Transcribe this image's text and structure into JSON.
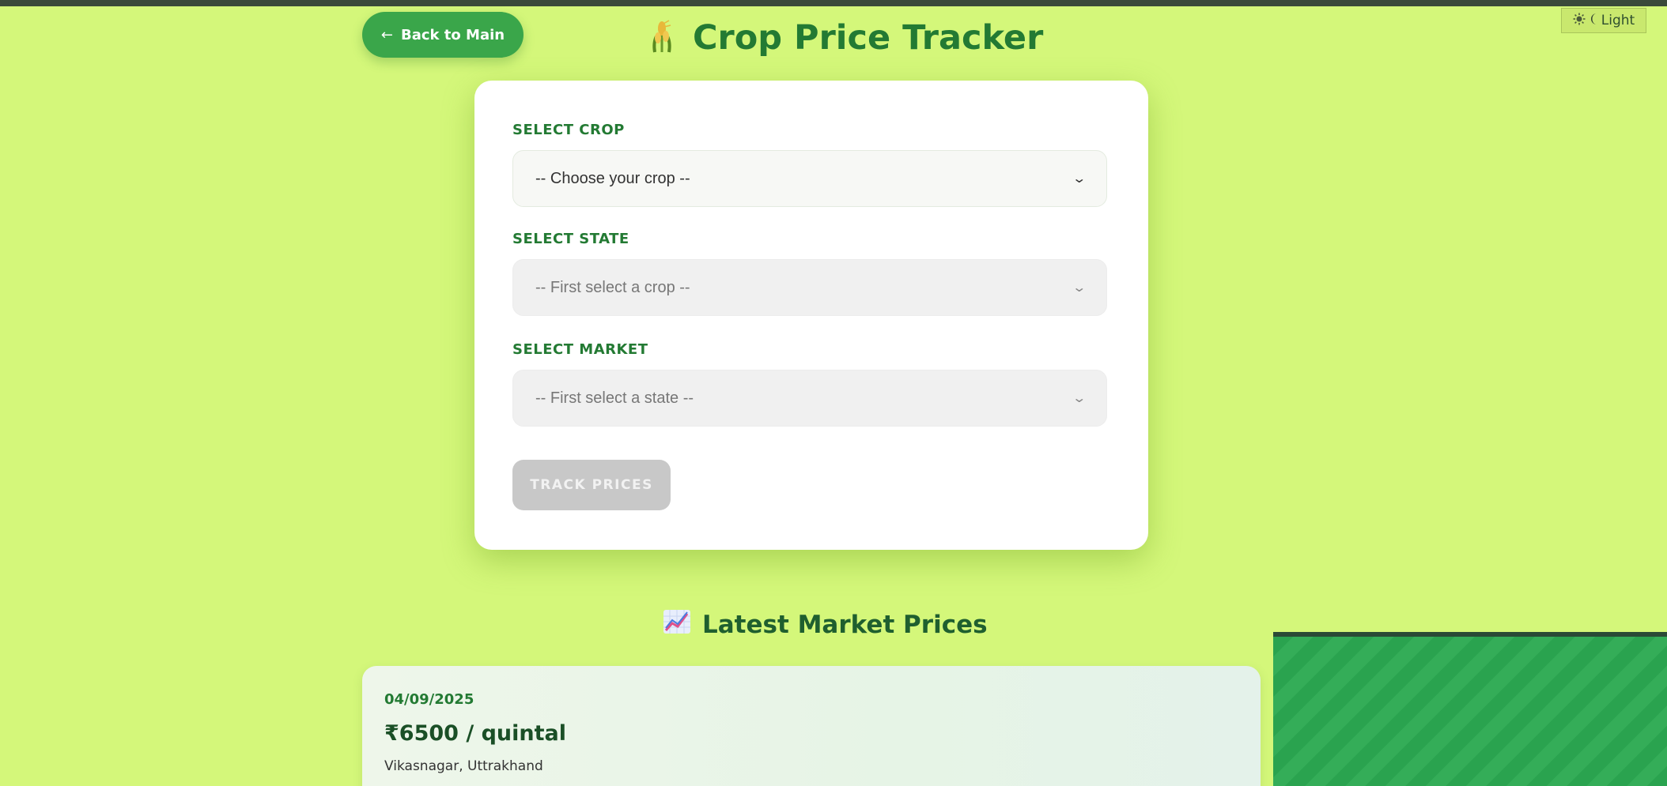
{
  "header": {
    "back_label": "Back to Main",
    "back_arrow": "←",
    "title": "Crop Price Tracker",
    "theme_toggle_label": "Light"
  },
  "form": {
    "crop": {
      "label": "SELECT CROP",
      "value": "-- Choose your crop --"
    },
    "state": {
      "label": "SELECT STATE",
      "value": "-- First select a crop --"
    },
    "market": {
      "label": "SELECT MARKET",
      "value": "-- First select a state --"
    },
    "submit_label": "TRACK PRICES"
  },
  "prices": {
    "section_title": "Latest Market Prices",
    "items": [
      {
        "date": "04/09/2025",
        "price": "₹6500 / quintal",
        "location": "Vikasnagar, Uttrakhand"
      }
    ]
  },
  "colors": {
    "background": "#d4f77a",
    "accent_green": "#3aa64a",
    "title_green": "#237a33",
    "disabled_button": "#c8c8c8"
  },
  "icons": {
    "back": "arrow-left-icon",
    "title": "wheat-icon",
    "theme": "sun-moon-icon",
    "chevron": "chevron-down-icon",
    "section": "chart-increasing-icon"
  }
}
